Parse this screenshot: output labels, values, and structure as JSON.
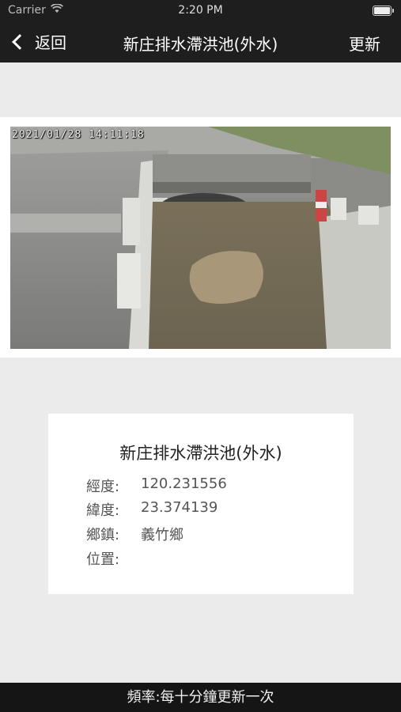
{
  "status_bar": {
    "carrier": "Carrier",
    "time": "2:20 PM"
  },
  "nav": {
    "back_label": "返回",
    "title": "新庄排水滯洪池(外水)",
    "refresh_label": "更新"
  },
  "camera": {
    "timestamp": "2021/01/28 14:11:18"
  },
  "info": {
    "name": "新庄排水滯洪池(外水)",
    "longitude_label": "經度:",
    "longitude": "120.231556",
    "latitude_label": "緯度:",
    "latitude": "23.374139",
    "township_label": "鄉鎮:",
    "township": "義竹鄉",
    "location_label": "位置:",
    "location": ""
  },
  "footer": {
    "frequency": "頻率:每十分鐘更新一次"
  }
}
